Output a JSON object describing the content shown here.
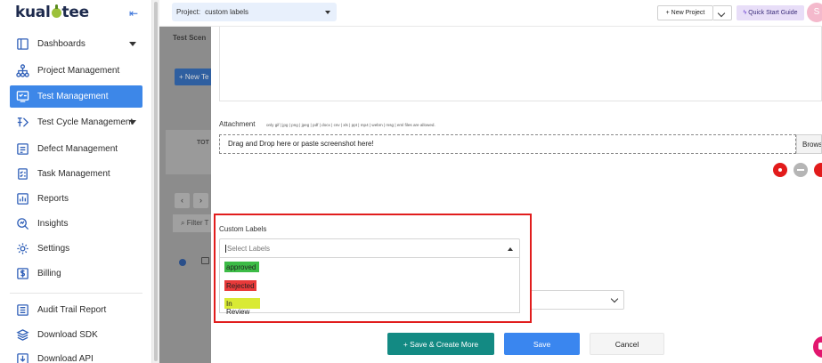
{
  "app": {
    "logo_text_left": "kual",
    "logo_text_right": "tee"
  },
  "sidebar": {
    "items": [
      {
        "label": "Dashboards",
        "icon": "dashboard-icon",
        "has_caret": true
      },
      {
        "label": "Project Management",
        "icon": "project-tree-icon"
      },
      {
        "label": "Test Management",
        "icon": "test-management-icon",
        "active": true
      },
      {
        "label": "Test Cycle Management",
        "icon": "test-cycle-icon",
        "has_caret": true
      },
      {
        "label": "Defect Management",
        "icon": "defect-icon"
      },
      {
        "label": "Task Management",
        "icon": "task-icon"
      },
      {
        "label": "Reports",
        "icon": "reports-icon"
      },
      {
        "label": "Insights",
        "icon": "insights-icon"
      },
      {
        "label": "Settings",
        "icon": "settings-icon"
      },
      {
        "label": "Billing",
        "icon": "billing-icon"
      },
      {
        "label": "Audit Trail Report",
        "icon": "audit-icon"
      },
      {
        "label": "Download SDK",
        "icon": "download-sdk-icon"
      },
      {
        "label": "Download API",
        "icon": "download-api-icon"
      }
    ]
  },
  "header": {
    "project_label": "Project:",
    "project_value": "custom labels",
    "new_project": "+ New Project",
    "quick_start": "Quick Start Guide",
    "avatar_initial": "S"
  },
  "background": {
    "tab_text": "Test Scen",
    "new_button": "+ New Te",
    "tot_text": "TOT",
    "filter_text": "Filter T"
  },
  "form": {
    "attachment_label": "Attachment",
    "attachment_hint": "only gif | jpg | png | jpeg | pdf | docx | csv | xls | ppt | mp4 | webm | msg | eml files are allowed.",
    "dropzone_text": "Drag and Drop here or paste screenshot here!",
    "browse_label": "Browse",
    "custom_labels_title": "Custom Labels",
    "custom_labels_placeholder": "Select Labels",
    "options": [
      {
        "label": "approved",
        "color": "#3cbb46"
      },
      {
        "label": "Rejected",
        "color": "#e83a3a"
      },
      {
        "label": "In Review",
        "color": "#d9ea34"
      }
    ]
  },
  "actions": {
    "save_create": "+ Save & Create More",
    "save": "Save",
    "cancel": "Cancel"
  },
  "colors": {
    "accent": "#3d87e8",
    "highlight_border": "#e11d1d",
    "teal": "#138a83"
  }
}
